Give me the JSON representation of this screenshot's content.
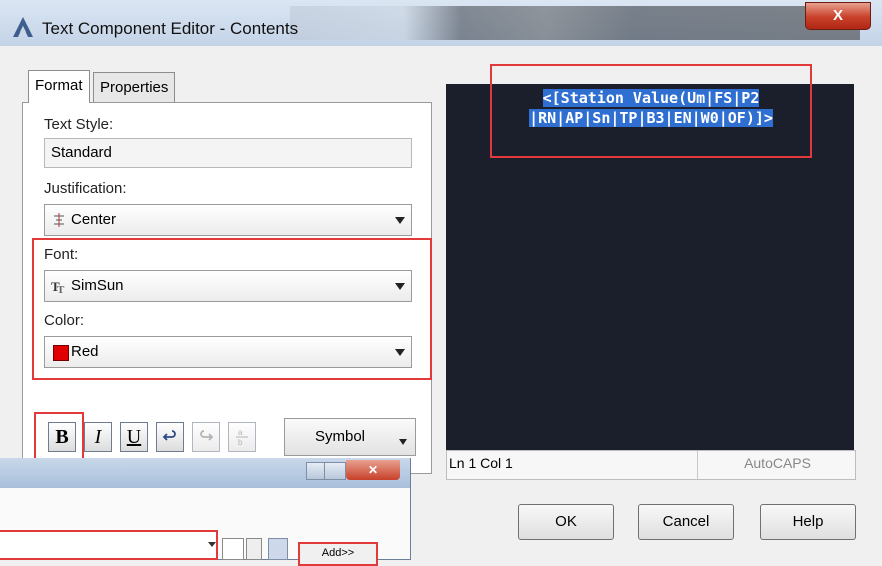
{
  "window": {
    "title": "Text Component Editor - Contents",
    "close_label": "X"
  },
  "tabs": [
    {
      "label": "Format",
      "selected": true
    },
    {
      "label": "Properties",
      "selected": false
    }
  ],
  "format": {
    "text_style": {
      "label": "Text Style:",
      "value": "Standard"
    },
    "justification": {
      "label": "Justification:",
      "value": "Center"
    },
    "font": {
      "label": "Font:",
      "value": "SimSun"
    },
    "color": {
      "label": "Color:",
      "value": "Red",
      "swatch": "#e10000"
    },
    "buttons": {
      "bold": "B",
      "italic": "I",
      "underline": "U"
    },
    "symbol_label": "Symbol"
  },
  "preview": {
    "line1": "<[Station Value(Um|FS|P2",
    "line2": "|RN|AP|Sn|TP|B3|EN|W0|OF)]>"
  },
  "status": {
    "position": "Ln 1 Col 1",
    "app": "AutoCAPS"
  },
  "dialog_buttons": {
    "ok": "OK",
    "cancel": "Cancel",
    "help": "Help"
  },
  "second_window": {
    "add_label": "Add>>"
  },
  "colors": {
    "highlight_red": "#e23a3a",
    "preview_bg": "#1b1e2b",
    "selection": "#2e6fd1"
  }
}
